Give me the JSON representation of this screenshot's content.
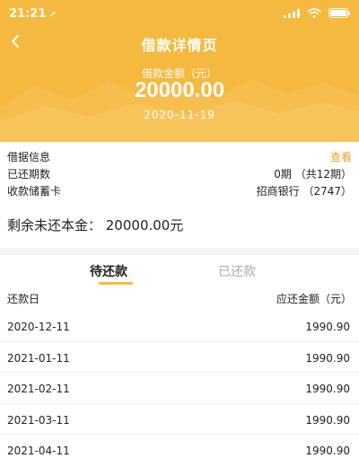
{
  "status_bar": {
    "time": "21:21",
    "location_arrow": "➚"
  },
  "nav": {
    "title": "借款详情页"
  },
  "loan": {
    "amount_label": "借款金额（元）",
    "amount": "20000.00",
    "date": "2020-11-19"
  },
  "info": {
    "receipt_label": "借据信息",
    "receipt_action": "查看",
    "periods_label": "已还期数",
    "periods_value": "0期 （共12期）",
    "card_label": "收款储蓄卡",
    "card_value": "招商银行 （2747）"
  },
  "remaining": {
    "text": "剩余未还本金：  20000.00元"
  },
  "tabs": {
    "pending": "待还款",
    "repaid": "已还款"
  },
  "table": {
    "col_date": "还款日",
    "col_amount": "应还金额（元）",
    "rows": [
      {
        "date": "2020-12-11",
        "amount": "1990.90"
      },
      {
        "date": "2021-01-11",
        "amount": "1990.90"
      },
      {
        "date": "2021-02-11",
        "amount": "1990.90"
      },
      {
        "date": "2021-03-11",
        "amount": "1990.90"
      },
      {
        "date": "2021-04-11",
        "amount": "1990.90"
      }
    ]
  },
  "colors": {
    "accent": "#f6b93f",
    "link": "#e6a128",
    "muted_tab": "#aaaaaa"
  }
}
